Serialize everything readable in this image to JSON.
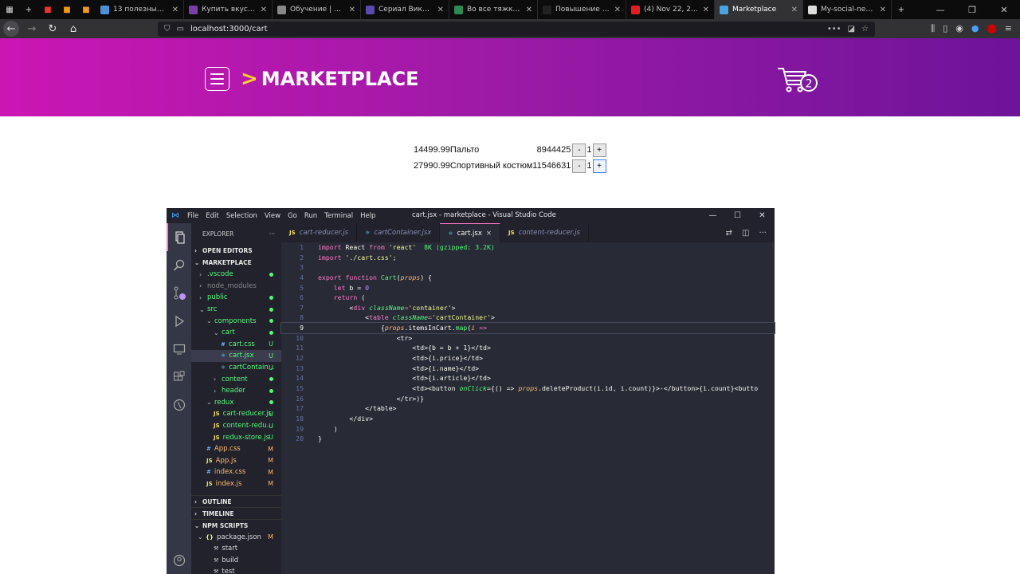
{
  "browser": {
    "pinned_tabs": [
      "",
      "",
      "",
      ""
    ],
    "tabs": [
      {
        "title": "13 полезных прил",
        "color": "#4a90d9"
      },
      {
        "title": "Купить вкусные по",
        "color": "#7b3ea8"
      },
      {
        "title": "Обучение | GeekBr",
        "color": "#888888"
      },
      {
        "title": "Сериал Викинги 1",
        "color": "#5a4ab0"
      },
      {
        "title": "Во все тяжкие 2 се",
        "color": "#2e8b57"
      },
      {
        "title": "Повышение произ",
        "color": "#222222"
      },
      {
        "title": "(4) Nov 22, 2020 - M",
        "color": "#e02020"
      },
      {
        "title": "Marketplace",
        "color": "#4aa3df",
        "active": true
      },
      {
        "title": "My-social-network",
        "color": "#dddddd"
      }
    ],
    "new_tab": "+",
    "url": "localhost:3000/cart"
  },
  "header": {
    "logo_chevron": ">",
    "logo_text": "MARKETPLACE",
    "cart_count": "2"
  },
  "cart": {
    "rows": [
      {
        "index": "1",
        "price": "4499.99",
        "name": "Пальто",
        "article": "8944425",
        "minus": "-",
        "count": "1",
        "plus": "+"
      },
      {
        "index": "2",
        "price": "7990.99",
        "name": "Спортивный костюм",
        "article": "11546631",
        "minus": "-",
        "count": "1",
        "plus": "+"
      }
    ]
  },
  "vscode": {
    "menu": [
      "File",
      "Edit",
      "Selection",
      "View",
      "Go",
      "Run",
      "Terminal",
      "Help"
    ],
    "window_title": "cart.jsx - marketplace - Visual Studio Code",
    "explorer_label": "EXPLORER",
    "sections": {
      "open_editors": "OPEN EDITORS",
      "project": "MARKETPLACE",
      "outline": "OUTLINE",
      "timeline": "TIMELINE",
      "npm": "NPM SCRIPTS"
    },
    "tree": [
      {
        "label": ".vscode",
        "indent": 0,
        "arrow": "›",
        "status": "dot"
      },
      {
        "label": "node_modules",
        "indent": 0,
        "arrow": "›",
        "status": "",
        "dim": true
      },
      {
        "label": "public",
        "indent": 0,
        "arrow": "›",
        "status": "dot"
      },
      {
        "label": "src",
        "indent": 0,
        "arrow": "⌄",
        "status": "dot"
      },
      {
        "label": "components",
        "indent": 1,
        "arrow": "⌄",
        "status": "dot"
      },
      {
        "label": "cart",
        "indent": 2,
        "arrow": "⌄",
        "status": "dot"
      },
      {
        "label": "cart.css",
        "indent": 3,
        "icon": "#",
        "status": "U"
      },
      {
        "label": "cart.jsx",
        "indent": 3,
        "icon": "⚛",
        "status": "U",
        "selected": true
      },
      {
        "label": "cartContain...",
        "indent": 3,
        "icon": "⚛",
        "status": "U"
      },
      {
        "label": "content",
        "indent": 2,
        "arrow": "›",
        "status": "dot"
      },
      {
        "label": "header",
        "indent": 2,
        "arrow": "›",
        "status": "dot"
      },
      {
        "label": "redux",
        "indent": 1,
        "arrow": "⌄",
        "status": "dot"
      },
      {
        "label": "cart-reducer.js",
        "indent": 2,
        "icon": "JS",
        "status": "U"
      },
      {
        "label": "content-redu...",
        "indent": 2,
        "icon": "JS",
        "status": "U"
      },
      {
        "label": "redux-store.js",
        "indent": 2,
        "icon": "JS",
        "status": "U"
      },
      {
        "label": "App.css",
        "indent": 1,
        "icon": "#",
        "status": "M"
      },
      {
        "label": "App.js",
        "indent": 1,
        "icon": "JS",
        "status": "M"
      },
      {
        "label": "index.css",
        "indent": 1,
        "icon": "#",
        "status": "M"
      },
      {
        "label": "index.js",
        "indent": 1,
        "icon": "JS",
        "status": "M"
      }
    ],
    "npm": {
      "package": "package.json",
      "package_status": "M",
      "scripts": [
        "start",
        "build",
        "test"
      ]
    },
    "tabs": [
      {
        "label": "cart-reducer.js",
        "icon": "JS"
      },
      {
        "label": "cartContainer.jsx",
        "icon": "⚛"
      },
      {
        "label": "cart.jsx",
        "icon": "⚛",
        "active": true,
        "close": "×"
      },
      {
        "label": "content-reducer.js",
        "icon": "JS"
      }
    ],
    "line_numbers": [
      "1",
      "2",
      "3",
      "4",
      "5",
      "6",
      "7",
      "8",
      "9",
      "10",
      "11",
      "12",
      "13",
      "14",
      "15",
      "16",
      "17",
      "18",
      "19",
      "20"
    ],
    "code_text": {
      "l1_import": "import",
      "l1_name": " React ",
      "l1_from": "from",
      "l1_str": " 'react'",
      "l1_size": "  8K (gzipped: 3.2K)",
      "l2_import": "import",
      "l2_str": " './cart.css'",
      "l2_semi": ";",
      "l4_kw": "export function",
      "l4_fn": " Cart",
      "l4_open": "(",
      "l4_param": "props",
      "l4_close": ") {",
      "l5_kw": "    let",
      "l5_rest": " b = ",
      "l5_num": "0",
      "l6_kw": "    return",
      "l6_rest": " (",
      "l7_pre": "        <",
      "l7_tag": "div",
      "l7_attr": " className",
      "l7_eq": "=",
      "l7_str": "'container'",
      "l7_end": ">",
      "l8_pre": "            <",
      "l8_tag": "table",
      "l8_attr": " className",
      "l8_eq": "=",
      "l8_str": "'cartContainer'",
      "l8_end": ">",
      "l9_pre": "                {",
      "l9_param": "props",
      "l9_mid": ".itemsInCart.",
      "l9_fn": "map",
      "l9_rest": "(",
      "l9_i": "i",
      "l9_arrow": " =>",
      "l10": "                    <tr>",
      "l11": "                        <td>{b = b + 1}</td>",
      "l12": "                        <td>{i.price}</td>",
      "l13": "                        <td>{i.name}</td>",
      "l14": "                        <td>{i.article}</td>",
      "l15_pre": "                        <td><button ",
      "l15_attr": "onClick",
      "l15_rest": "={() => ",
      "l15_param": "props",
      "l15_mid": ".deleteProduct(i.id, i.count)}>-</button>{i.count}<butto",
      "l16": "                    </tr>)}",
      "l17": "            </table>",
      "l18": "        </div>",
      "l19": "    )",
      "l20": "}"
    }
  }
}
